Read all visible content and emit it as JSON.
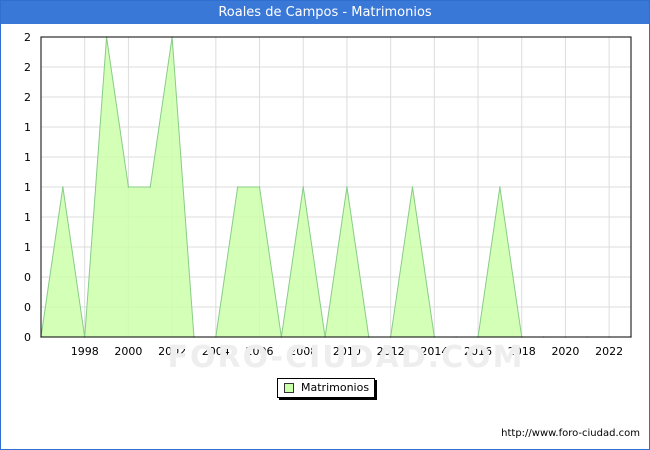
{
  "title": "Roales de Campos - Matrimonios",
  "source_url": "http://www.foro-ciudad.com",
  "watermark": "FORO-CIUDAD.COM",
  "colors": {
    "title_bg": "#3a78d8",
    "fill": "#ccffaa",
    "line": "#88cc88",
    "grid": "#dddddd"
  },
  "chart_data": {
    "type": "area",
    "title": "Roales de Campos - Matrimonios",
    "xlabel": "",
    "ylabel": "",
    "x": [
      1996,
      1997,
      1998,
      1999,
      2000,
      2001,
      2002,
      2003,
      2004,
      2005,
      2006,
      2007,
      2008,
      2009,
      2010,
      2011,
      2012,
      2013,
      2014,
      2015,
      2016,
      2017,
      2018,
      2019,
      2020,
      2021,
      2022,
      2023
    ],
    "series": [
      {
        "name": "Matrimonios",
        "values": [
          0,
          1,
          0,
          2,
          1,
          1,
          2,
          0,
          0,
          1,
          1,
          0,
          1,
          0,
          1,
          0,
          0,
          1,
          0,
          0,
          0,
          1,
          0,
          0,
          0,
          0,
          0,
          0
        ]
      }
    ],
    "xlim": [
      1996,
      2023
    ],
    "ylim": [
      0,
      2
    ],
    "x_ticks": [
      1998,
      2000,
      2002,
      2004,
      2006,
      2008,
      2010,
      2012,
      2014,
      2016,
      2018,
      2020,
      2022
    ],
    "y_tick_labels": [
      "0",
      "0",
      "0",
      "1",
      "1",
      "1",
      "1",
      "1",
      "2",
      "2",
      "2"
    ],
    "grid": true,
    "legend": {
      "position": "bottom-center",
      "entries": [
        "Matrimonios"
      ]
    }
  }
}
